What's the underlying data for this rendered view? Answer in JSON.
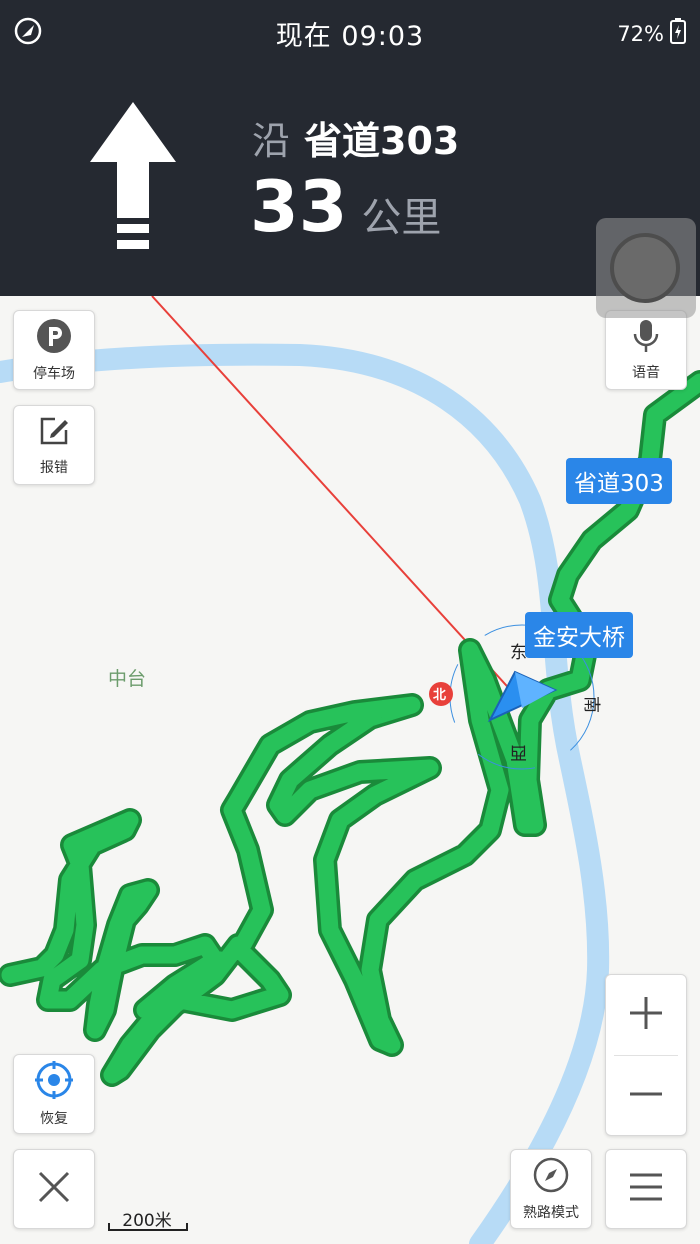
{
  "status_bar": {
    "time_label": "现在 09:03",
    "battery": "72%"
  },
  "guidance": {
    "direction": "straight",
    "road_prefix": "沿",
    "road_name": "省道303",
    "distance_value": "33",
    "distance_unit": "公里"
  },
  "map": {
    "place_label": "中台",
    "road_callout": "省道303",
    "bridge_callout": "金安大桥",
    "compass": {
      "north": "北",
      "east": "东",
      "south": "南",
      "west": "西"
    },
    "scale_label": "200米"
  },
  "buttons": {
    "parking": "停车场",
    "report": "报错",
    "voice": "语音",
    "recenter": "恢复",
    "familiar_mode": "熟路模式"
  },
  "colors": {
    "route_green": "#27c25a",
    "route_outline": "#1a8a3a",
    "river": "#b7dbf6",
    "accent_blue": "#2a86e8",
    "banner_bg": "#252931"
  }
}
